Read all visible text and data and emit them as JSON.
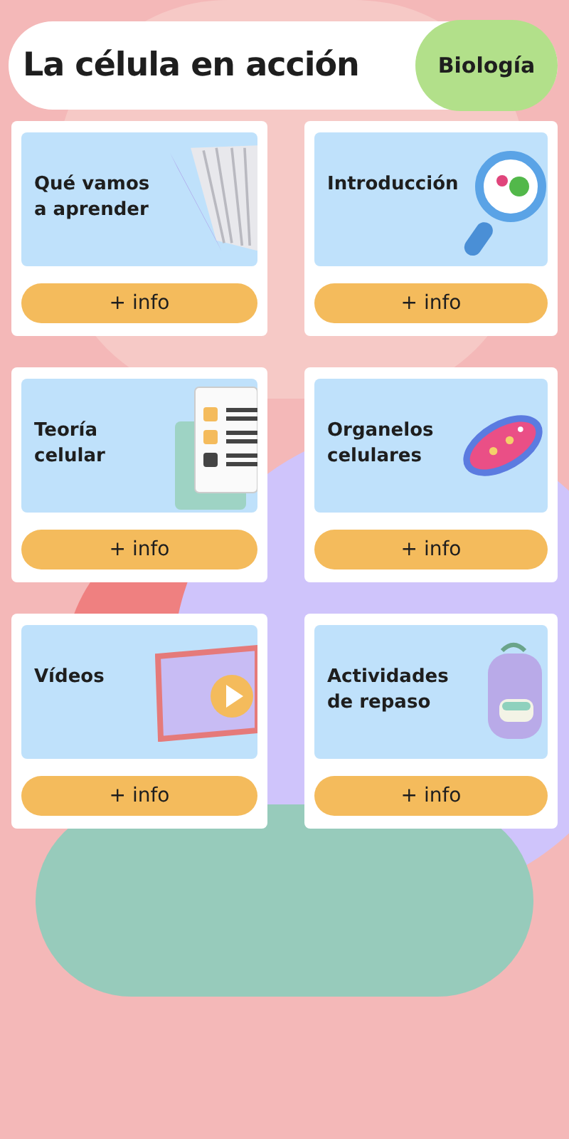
{
  "header": {
    "title": "La célula en acción",
    "subject": "Biología"
  },
  "cards": [
    {
      "title": "Qué vamos a aprender",
      "kind": "book",
      "button": "+ info"
    },
    {
      "title": "Introducción",
      "kind": "magnifier",
      "button": "+ info"
    },
    {
      "title": "Teoría celular",
      "kind": "checklist",
      "button": "+ info"
    },
    {
      "title": "Organelos celulares",
      "kind": "organelle",
      "button": "+ info"
    },
    {
      "title": "Vídeos",
      "kind": "video",
      "button": "+ info"
    },
    {
      "title": "Actividades de repaso",
      "kind": "backpack",
      "button": "+ info"
    }
  ]
}
